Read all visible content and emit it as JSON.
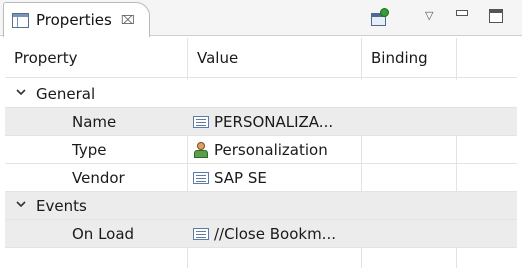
{
  "view": {
    "tab_title": "Properties",
    "tab_close_glyph": "⌧",
    "menu_glyph": "▽"
  },
  "table": {
    "columns": [
      "Property",
      "Value",
      "Binding"
    ],
    "groups": [
      {
        "label": "General",
        "expanded": true,
        "rows": [
          {
            "property": "Name",
            "value": "PERSONALIZA...",
            "icon": "text-value-icon",
            "shaded": true
          },
          {
            "property": "Type",
            "value": "Personalization",
            "icon": "person-icon",
            "shaded": false
          },
          {
            "property": "Vendor",
            "value": "SAP SE",
            "icon": "text-value-icon",
            "shaded": false
          }
        ]
      },
      {
        "label": "Events",
        "expanded": true,
        "rows": [
          {
            "property": "On Load",
            "value": "//Close Bookm...",
            "icon": "text-value-icon",
            "shaded": true
          }
        ]
      }
    ]
  },
  "colors": {
    "row_shade": "#ececec",
    "grid_line": "#e3e3e3",
    "header_bg": "#f5f5f5"
  }
}
